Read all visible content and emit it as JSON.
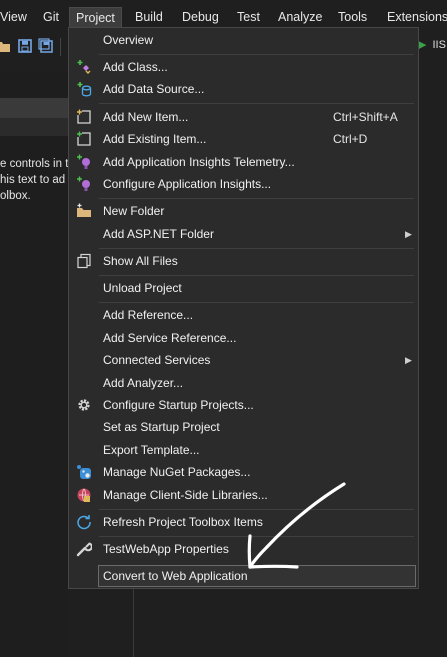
{
  "menubar": {
    "items": [
      "View",
      "Git",
      "Project",
      "Build",
      "Debug",
      "Test",
      "Analyze",
      "Tools",
      "Extensions"
    ],
    "active": "Project"
  },
  "toolbar": {
    "right_label": "IIS"
  },
  "left_panel": {
    "lines": [
      "e controls in t",
      "his text to ad",
      "olbox."
    ]
  },
  "project_menu": {
    "items": [
      {
        "label": "Overview",
        "icon": "none"
      },
      {
        "label": "Add Class...",
        "icon": "add-class-icon"
      },
      {
        "label": "Add Data Source...",
        "icon": "add-data-source-icon"
      },
      {
        "label": "Add New Item...",
        "shortcut": "Ctrl+Shift+A",
        "icon": "add-new-item-icon"
      },
      {
        "label": "Add Existing Item...",
        "shortcut": "Ctrl+D",
        "icon": "add-existing-item-icon"
      },
      {
        "label": "Add Application Insights Telemetry...",
        "icon": "app-insights-icon"
      },
      {
        "label": "Configure Application Insights...",
        "icon": "app-insights-icon"
      },
      {
        "label": "New Folder",
        "icon": "new-folder-icon"
      },
      {
        "label": "Add ASP.NET Folder",
        "icon": "none",
        "submenu": true
      },
      {
        "label": "Show All Files",
        "icon": "show-all-files-icon"
      },
      {
        "label": "Unload Project",
        "icon": "none"
      },
      {
        "label": "Add Reference...",
        "icon": "none"
      },
      {
        "label": "Add Service Reference...",
        "icon": "none"
      },
      {
        "label": "Connected Services",
        "icon": "none",
        "submenu": true
      },
      {
        "label": "Add Analyzer...",
        "icon": "none"
      },
      {
        "label": "Configure Startup Projects...",
        "icon": "gear-icon"
      },
      {
        "label": "Set as Startup Project",
        "icon": "none"
      },
      {
        "label": "Export Template...",
        "icon": "none"
      },
      {
        "label": "Manage NuGet Packages...",
        "icon": "nuget-icon"
      },
      {
        "label": "Manage Client-Side Libraries...",
        "icon": "libman-icon"
      },
      {
        "label": "Refresh Project Toolbox Items",
        "icon": "refresh-icon"
      },
      {
        "label": "TestWebApp Properties",
        "icon": "wrench-icon"
      },
      {
        "label": "Convert to Web Application",
        "icon": "none",
        "highlighted": true
      }
    ]
  },
  "colors": {
    "menu_bg": "#2b2b2b",
    "menubar_bg": "#1f1f1f",
    "highlight_border": "#6a6a6a",
    "text": "#f1f1f1"
  }
}
